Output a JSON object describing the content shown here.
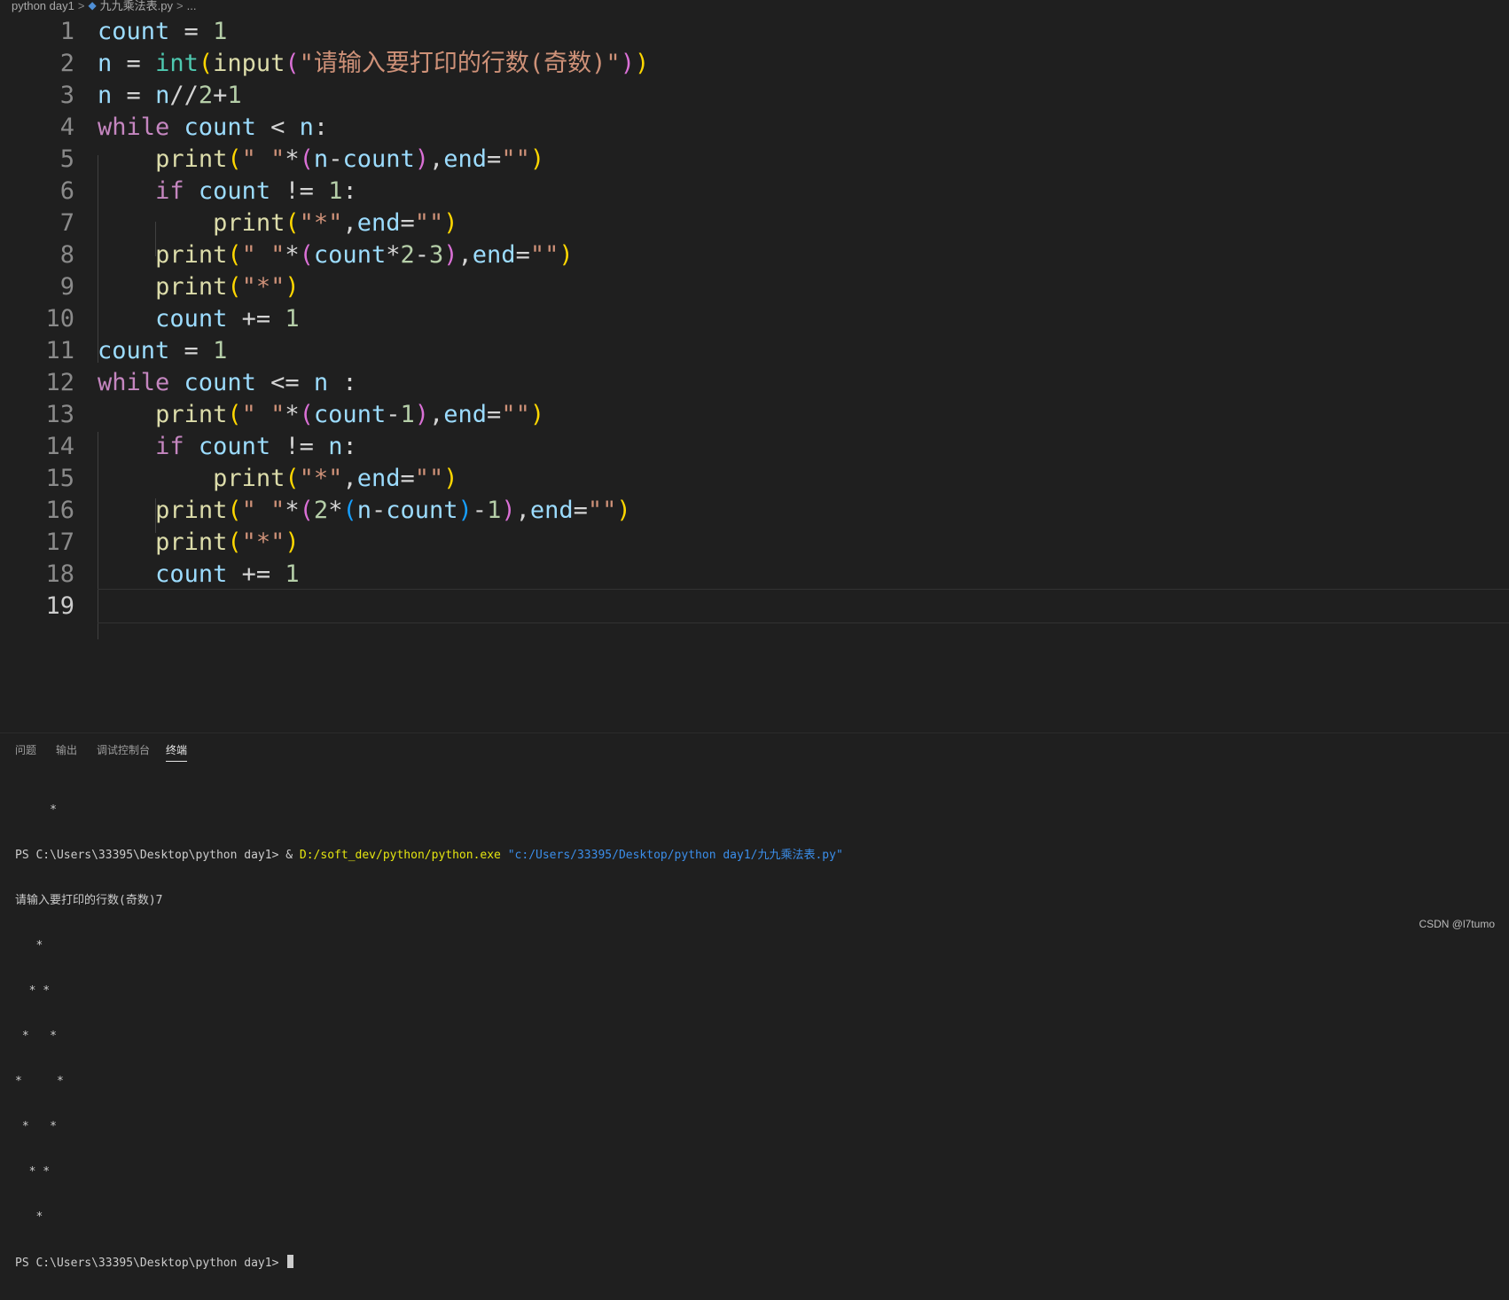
{
  "breadcrumb": {
    "folder": "python day1",
    "file": "九九乘法表.py",
    "more": "...",
    "separator": ">"
  },
  "editor": {
    "line_numbers": [
      "1",
      "2",
      "3",
      "4",
      "5",
      "6",
      "7",
      "8",
      "9",
      "10",
      "11",
      "12",
      "13",
      "14",
      "15",
      "16",
      "17",
      "18",
      "19"
    ],
    "active_line": "19",
    "lines": [
      "count = 1",
      "n = int(input(\"请输入要打印的行数(奇数)\"))",
      "n = n//2+1",
      "while count < n:",
      "    print(\" \"*(n-count),end=\"\")",
      "    if count != 1:",
      "        print(\"*\",end=\"\")",
      "    print(\" \"*(count*2-3),end=\"\")",
      "    print(\"*\")",
      "    count += 1",
      "count = 1",
      "while count <= n :",
      "    print(\" \"*(count-1),end=\"\")",
      "    if count != n:",
      "        print(\"*\",end=\"\")",
      "    print(\" \"*(2*(n-count)-1),end=\"\")",
      "    print(\"*\")",
      "    count += 1",
      ""
    ]
  },
  "panel": {
    "tabs": [
      {
        "label": "问题",
        "active": false
      },
      {
        "label": "输出",
        "active": false
      },
      {
        "label": "调试控制台",
        "active": false
      },
      {
        "label": "终端",
        "active": true
      }
    ],
    "terminal": {
      "top_star": "     *",
      "cmd_prompt": "PS C:\\Users\\33395\\Desktop\\python day1> ",
      "cmd_amp": "& ",
      "cmd_exe": "D:/soft_dev/python/python.exe",
      "cmd_space": " ",
      "cmd_path": "\"c:/Users/33395/Desktop/python day1/九九乘法表.py\"",
      "input_line": "请输入要打印的行数(奇数)7",
      "diamond": [
        "   *",
        "  * *",
        " *   *",
        "*     *",
        " *   *",
        "  * *",
        "   *"
      ],
      "final_prompt": "PS C:\\Users\\33395\\Desktop\\python day1> "
    }
  },
  "watermark": "CSDN @l7tumo",
  "colors": {
    "keyword": "#c586c0",
    "function": "#dcdcaa",
    "builtin": "#4ec9b0",
    "string": "#ce9178",
    "number": "#b5cea8",
    "variable": "#9cdcfe",
    "terminal_exe": "#e5e510",
    "terminal_path": "#3b8eea"
  }
}
